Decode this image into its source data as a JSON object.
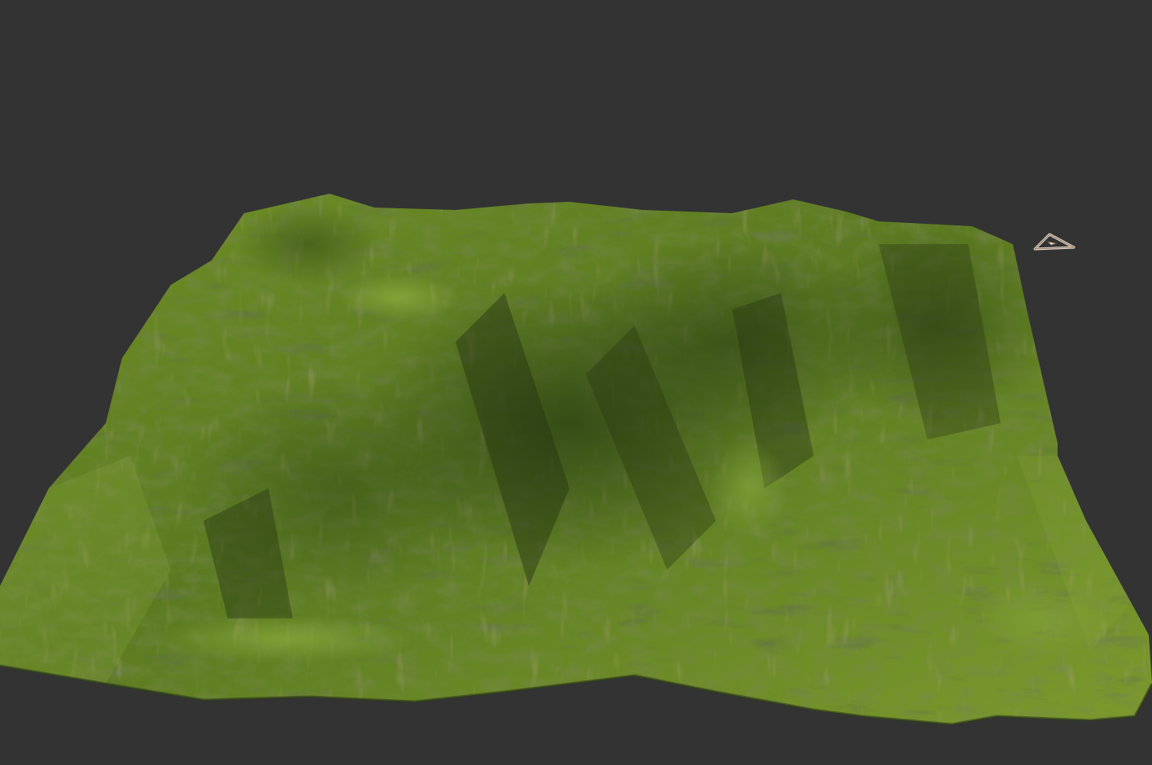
{
  "viewport": {
    "background_color": "#333333"
  },
  "terrain": {
    "palette": {
      "grass_light": "#7a9a2a",
      "grass_mid": "#5f7f22",
      "grass_dark": "#3c5418",
      "shadow": "#243312",
      "rock": "#7a6a4a",
      "valley": "#6f8f2c"
    }
  },
  "gizmo": {
    "icon": "camera-frustum-icon",
    "stroke_color": "#e8e4dc",
    "accent_color": "#8a6a4a"
  }
}
